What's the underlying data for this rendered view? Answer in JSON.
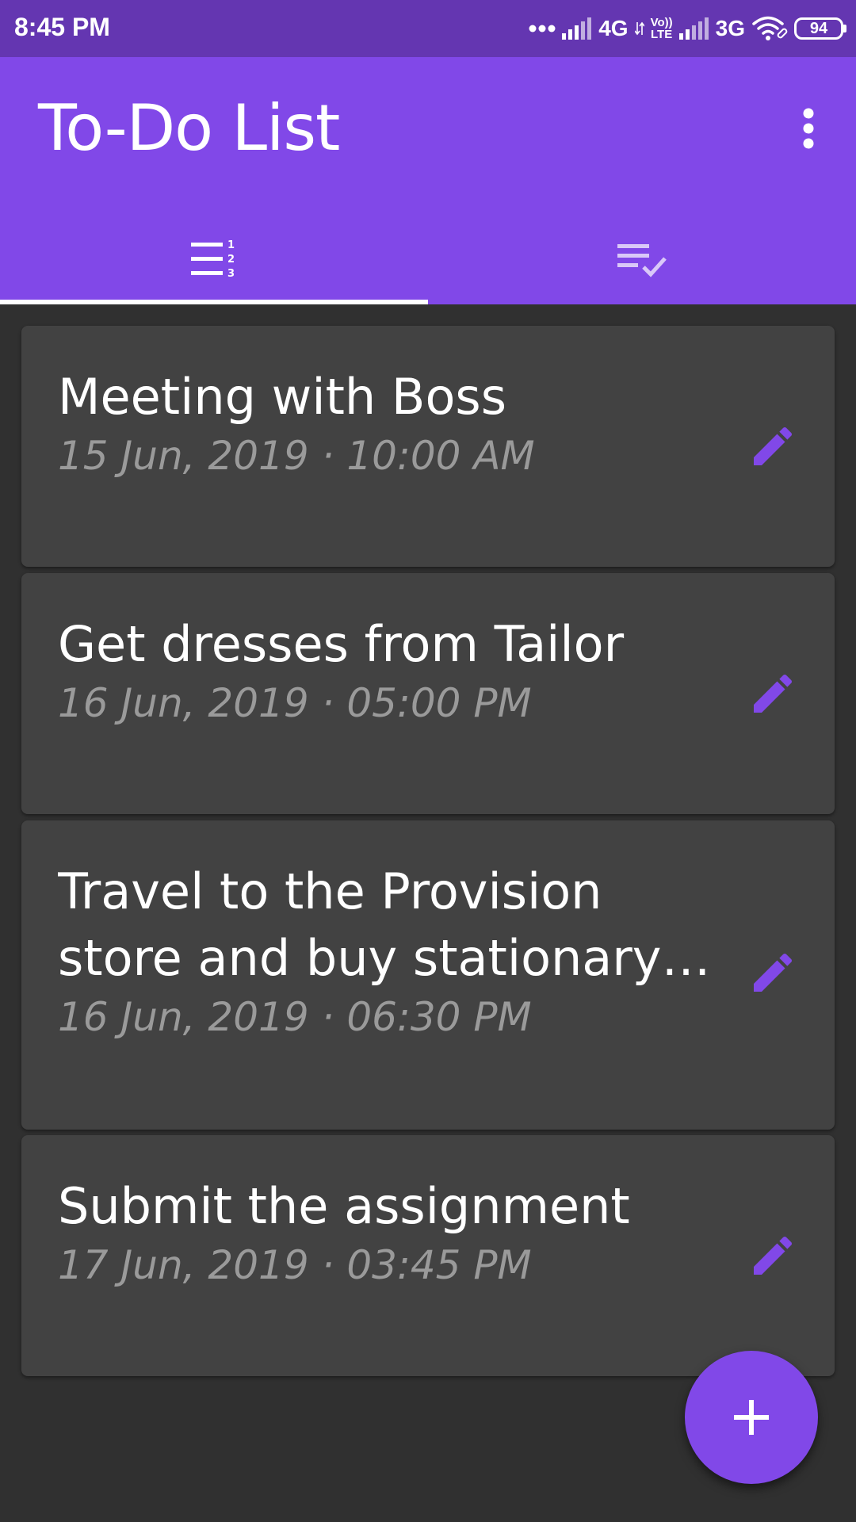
{
  "status_bar": {
    "time": "8:45 PM",
    "network_1": "4G",
    "volte_top": "Vo))",
    "volte_bottom": "LTE",
    "network_2": "3G",
    "battery": "94"
  },
  "app_bar": {
    "title": "To-Do List",
    "menu_icon": "more-vert-icon"
  },
  "tabs": [
    {
      "icon": "numbered-list-icon",
      "selected": true
    },
    {
      "icon": "playlist-check-icon",
      "selected": false
    }
  ],
  "tasks": [
    {
      "title": "Meeting with Boss",
      "date": "15 Jun, 2019 · 10:00 AM"
    },
    {
      "title": "Get dresses from Tailor",
      "date": "16 Jun, 2019 · 05:00 PM"
    },
    {
      "title": "Travel to the Provision store and buy stationary items for",
      "date": "16 Jun, 2019 · 06:30 PM"
    },
    {
      "title": "Submit the assignment",
      "date": "17 Jun, 2019 · 03:45 PM"
    }
  ],
  "fab": {
    "icon": "add-icon"
  },
  "colors": {
    "status_bar": "#6436b1",
    "app_bar": "#8148e8",
    "accent": "#8148e8",
    "background": "#303030",
    "card": "#424242",
    "date_text": "#9a9a9a"
  }
}
